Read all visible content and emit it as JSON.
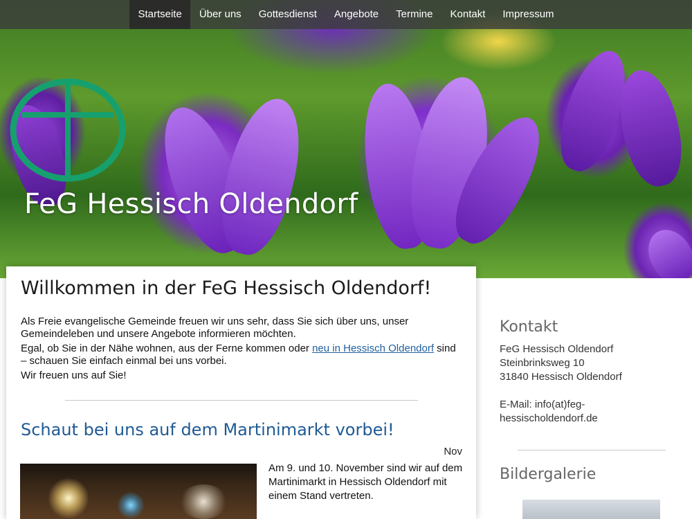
{
  "nav": {
    "items": [
      {
        "label": "Startseite",
        "active": true
      },
      {
        "label": "Über uns",
        "active": false
      },
      {
        "label": "Gottesdienst",
        "active": false
      },
      {
        "label": "Angebote",
        "active": false
      },
      {
        "label": "Termine",
        "active": false
      },
      {
        "label": "Kontakt",
        "active": false
      },
      {
        "label": "Impressum",
        "active": false
      }
    ]
  },
  "header": {
    "site_title": "FeG Hessisch Oldendorf",
    "logo_icon": "cross-circle-logo",
    "logo_color": "#1a9a6a"
  },
  "main": {
    "heading": "Willkommen in der FeG Hessisch Oldendorf!",
    "intro": {
      "p1": "Als Freie evangelische Gemeinde freuen wir uns sehr, dass Sie sich über uns, unser Gemeindeleben und unsere Angebote informieren möchten.",
      "p2_before": "Egal, ob Sie in der Nähe wohnen, aus der Ferne kommen oder ",
      "p2_link": "neu in Hessisch Oldendorf",
      "p2_after": " sind – schauen Sie einfach einmal bei uns vorbei.",
      "p3": "Wir freuen uns auf Sie!"
    },
    "post": {
      "title": "Schaut bei uns auf dem Martinimarkt vorbei!",
      "date": "Nov",
      "text": "Am 9. und 10. November sind wir auf dem Martinimarkt in Hessisch Oldendorf mit einem Stand vertreten."
    },
    "link_color": "#1f5f9e",
    "post_title_color": "#1f5a94"
  },
  "sidebar": {
    "contact_heading": "Kontakt",
    "contact_lines": [
      "FeG Hessisch Oldendorf",
      "Steinbrinksweg 10",
      "31840 Hessisch Oldendorf",
      "",
      "E-Mail: info(at)feg-",
      "hessischoldendorf.de"
    ],
    "gallery_heading": "Bildergalerie"
  }
}
